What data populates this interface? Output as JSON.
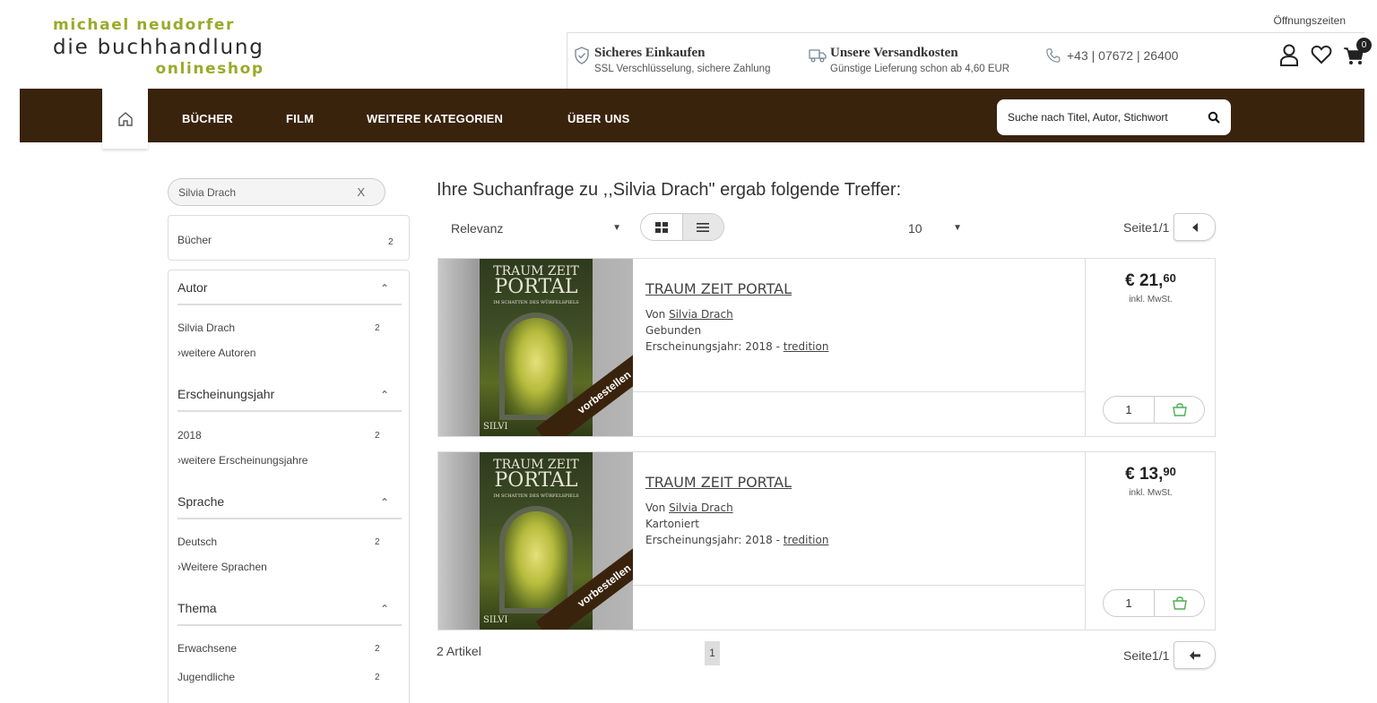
{
  "header": {
    "logo": {
      "line1": "michael neudorfer",
      "line2": "die buchhandlung",
      "line3": "onlineshop"
    },
    "opening_hours_link": "Öffnungszeiten",
    "info": [
      {
        "icon": "shield-check-icon",
        "title": "Sicheres Einkaufen",
        "subtitle": "SSL Verschlüsselung, sichere Zahlung"
      },
      {
        "icon": "truck-icon",
        "title": "Unsere Versandkosten",
        "subtitle": "Günstige Lieferung schon ab 4,60 EUR"
      }
    ],
    "phone": "+43 | 07672 | 26400",
    "cart_count": "0"
  },
  "nav": {
    "items": [
      "BÜCHER",
      "FILM",
      "WEITERE KATEGORIEN",
      "ÜBER UNS"
    ],
    "search_placeholder": "Suche nach Titel, Autor, Stichwort"
  },
  "sidebar": {
    "search_value": "Silvia Drach",
    "clear": "X",
    "category": {
      "label": "Bücher",
      "count": "2"
    },
    "facets": [
      {
        "title": "Autor",
        "items": [
          {
            "label": "Silvia Drach",
            "count": "2"
          }
        ],
        "more": "›weitere Autoren"
      },
      {
        "title": "Erscheinungsjahr",
        "items": [
          {
            "label": "2018",
            "count": "2"
          }
        ],
        "more": "›weitere Erscheinungsjahre"
      },
      {
        "title": "Sprache",
        "items": [
          {
            "label": "Deutsch",
            "count": "2"
          }
        ],
        "more": "›Weitere Sprachen"
      },
      {
        "title": "Thema",
        "items": [
          {
            "label": "Erwachsene",
            "count": "2"
          },
          {
            "label": "Jugendliche",
            "count": "2"
          }
        ],
        "more": ""
      }
    ]
  },
  "results": {
    "heading": "Ihre Suchanfrage zu ,,Silvia Drach\" ergab folgende Treffer:",
    "sort": "Relevanz",
    "per_page": "10",
    "page_label": "Seite1/1",
    "total": "2 Artikel",
    "current_page": "1",
    "products": [
      {
        "cover_title1": "TRAUM ZEIT",
        "cover_title2": "PORTAL",
        "cover_sub": "IM SCHATTEN DES WÜRFELSPIELS",
        "cover_author": "SILVI",
        "ribbon": "vorbestellen",
        "title": "TRAUM ZEIT PORTAL",
        "by_label": "Von",
        "author": "Silvia Drach",
        "format": "Gebunden",
        "year_label": "Erscheinungsjahr: 2018 -",
        "publisher": "tredition",
        "price_main": "€ 21,",
        "price_cents": "60",
        "vat": "inkl. MwSt.",
        "qty": "1"
      },
      {
        "cover_title1": "TRAUM ZEIT",
        "cover_title2": "PORTAL",
        "cover_sub": "IM SCHATTEN DES WÜRFELSPIELS",
        "cover_author": "SILVI",
        "ribbon": "vorbestellen",
        "title": "TRAUM ZEIT PORTAL",
        "by_label": "Von",
        "author": "Silvia Drach",
        "format": "Kartoniert",
        "year_label": "Erscheinungsjahr: 2018 -",
        "publisher": "tredition",
        "price_main": "€ 13,",
        "price_cents": "90",
        "vat": "inkl. MwSt.",
        "qty": "1"
      }
    ]
  },
  "colors": {
    "nav_bg": "#3a230c",
    "logo_green": "#9aaa2a",
    "cart_green": "#4caf50"
  }
}
